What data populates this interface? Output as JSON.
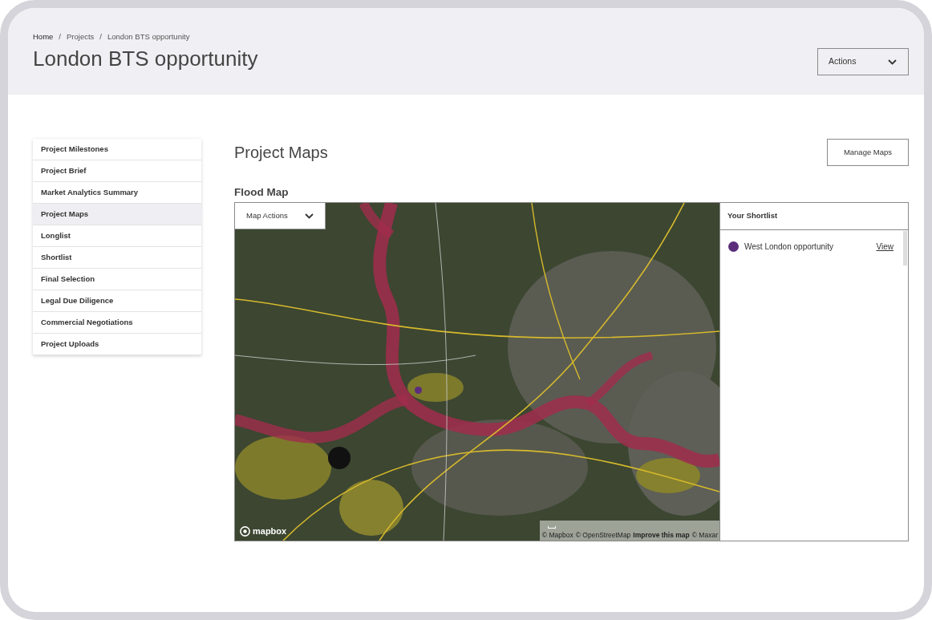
{
  "header": {
    "breadcrumb": [
      {
        "kind": "home",
        "text": "Home"
      },
      {
        "kind": "separator",
        "text": "/"
      },
      {
        "kind": "link",
        "text": "Projects"
      },
      {
        "kind": "separator",
        "text": "/"
      },
      {
        "kind": "current",
        "text": "London BTS opportunity"
      }
    ],
    "title": "London BTS opportunity",
    "actions_dropdown": {
      "label": "Actions"
    }
  },
  "sidebar": {
    "items": [
      {
        "label": "Project Milestones",
        "selected": false
      },
      {
        "label": "Project Brief",
        "selected": false
      },
      {
        "label": "Market Analytics Summary",
        "selected": false
      },
      {
        "label": "Project Maps",
        "selected": true
      },
      {
        "label": "Longlist",
        "selected": false
      },
      {
        "label": "Shortlist",
        "selected": false
      },
      {
        "label": "Final Selection",
        "selected": false
      },
      {
        "label": "Legal Due Diligence",
        "selected": false
      },
      {
        "label": "Commercial Negotiations",
        "selected": false
      },
      {
        "label": "Project Uploads",
        "selected": false
      }
    ]
  },
  "main": {
    "title": "Project Maps",
    "manage_button": "Manage Maps",
    "section_title": "Flood Map",
    "map": {
      "actions_dropdown": {
        "label": "Map Actions"
      },
      "markers": [
        {
          "color": "#5b2d7a"
        }
      ],
      "logo": "mapbox",
      "attribution": [
        {
          "text": "© Mapbox",
          "bold": false
        },
        {
          "text": "© OpenStreetMap",
          "bold": false
        },
        {
          "text": "Improve this map",
          "bold": true
        },
        {
          "text": "© Maxar",
          "bold": false
        }
      ]
    },
    "shortlist": {
      "title": "Your Shortlist",
      "items": [
        {
          "name": "West London opportunity",
          "color": "#5b2d7a",
          "link": "View"
        }
      ]
    }
  }
}
